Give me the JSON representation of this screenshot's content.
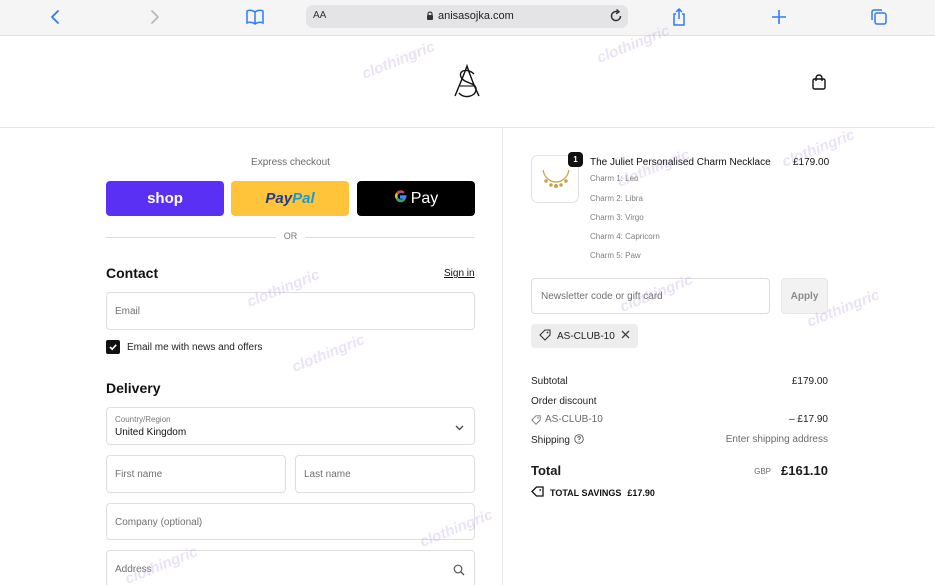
{
  "browser": {
    "url": "anisasojka.com",
    "text_size_label": "AA"
  },
  "store": {
    "logo_text": "AS"
  },
  "checkout": {
    "express_label": "Express checkout",
    "shop_label": "shop",
    "paypal_label_a": "Pay",
    "paypal_label_b": "Pal",
    "gpay_label": "Pay",
    "or_label": "OR",
    "contact_title": "Contact",
    "sign_in_label": "Sign in",
    "email_placeholder": "Email",
    "newsletter_label": "Email me with news and offers",
    "newsletter_checked": true,
    "delivery_title": "Delivery",
    "country_label": "Country/Region",
    "country_value": "United Kingdom",
    "first_name_placeholder": "First name",
    "last_name_placeholder": "Last name",
    "company_placeholder": "Company (optional)",
    "address_placeholder": "Address"
  },
  "order": {
    "item": {
      "quantity": "1",
      "name": "The Juliet Personalised Charm Necklace",
      "price": "£179.00",
      "charms": [
        "Charm 1: Leo",
        "Charm 2: Libra",
        "Charm 3: Virgo",
        "Charm 4: Capricorn",
        "Charm 5: Paw"
      ]
    },
    "discount_placeholder": "Newsletter code or gift card",
    "apply_label": "Apply",
    "applied_code": "AS-CLUB-10",
    "subtotal_label": "Subtotal",
    "subtotal_value": "£179.00",
    "order_discount_label": "Order discount",
    "discount_code": "AS-CLUB-10",
    "discount_value": "– £17.90",
    "shipping_label": "Shipping",
    "shipping_value": "Enter shipping address",
    "total_label": "Total",
    "currency": "GBP",
    "total_value": "£161.10",
    "savings_label": "TOTAL SAVINGS",
    "savings_value": "£17.90"
  },
  "watermark": "clothingric"
}
